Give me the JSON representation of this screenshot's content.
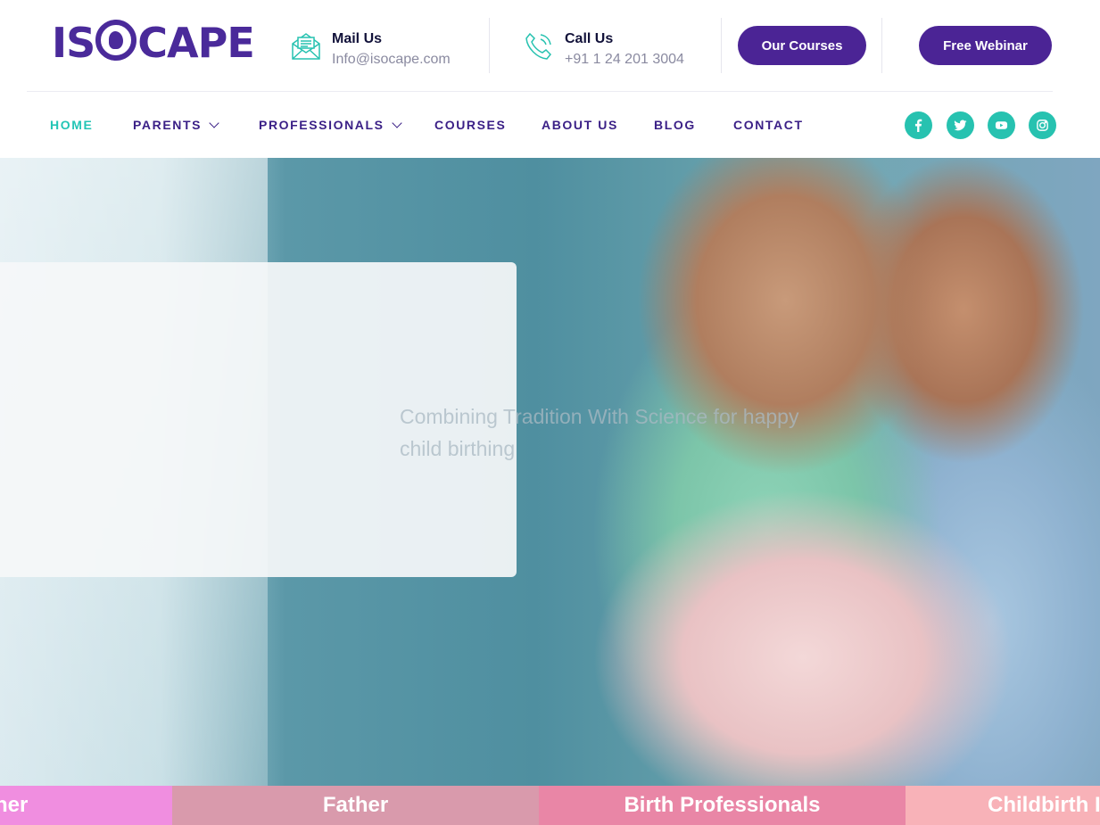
{
  "brand": {
    "logo_text_left": "IS",
    "logo_text_right": "CAPE",
    "color": "#4b2495"
  },
  "header": {
    "mail": {
      "title": "Mail Us",
      "value": "Info@isocape.com",
      "icon": "envelope-icon"
    },
    "call": {
      "title": "Call Us",
      "value": "+91 1 24 201 3004",
      "icon": "phone-icon"
    },
    "buttons": {
      "courses": "Our Courses",
      "webinar": "Free Webinar"
    }
  },
  "nav": {
    "items": [
      {
        "label": "HOME",
        "active": true
      },
      {
        "label": "PARENTS",
        "has_dropdown": true
      },
      {
        "label": "PROFESSIONALS",
        "has_dropdown": true
      },
      {
        "label": "COURSES"
      },
      {
        "label": "ABOUT US"
      },
      {
        "label": "BLOG"
      },
      {
        "label": "CONTACT"
      }
    ],
    "social": [
      "facebook-icon",
      "twitter-icon",
      "youtube-icon",
      "instagram-icon"
    ],
    "accent": "#23c5b5"
  },
  "hero": {
    "tagline_line1": "Combining Tradition With Science for happy",
    "tagline_line2": "child birthing"
  },
  "categories": [
    {
      "label": "Mother",
      "visible_text": "her",
      "color": "#f08ee0"
    },
    {
      "label": "Father",
      "color": "#d99aac"
    },
    {
      "label": "Birth Professionals",
      "color": "#e986a6"
    },
    {
      "label": "Childbirth",
      "visible_text": "Childbirth I",
      "color": "#f8b2b8"
    }
  ]
}
